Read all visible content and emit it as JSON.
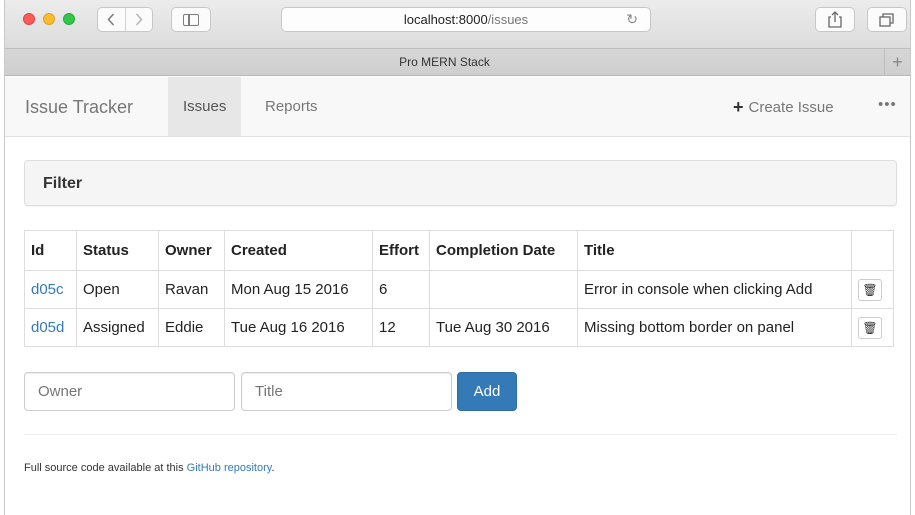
{
  "browser": {
    "url_host": "localhost:8000",
    "url_path": "/issues",
    "tab_title": "Pro MERN Stack"
  },
  "nav": {
    "brand": "Issue Tracker",
    "links": [
      "Issues",
      "Reports"
    ],
    "active": "Issues",
    "create_issue": "Create Issue"
  },
  "filter": {
    "title": "Filter"
  },
  "table": {
    "columns": [
      "Id",
      "Status",
      "Owner",
      "Created",
      "Effort",
      "Completion Date",
      "Title"
    ],
    "rows": [
      {
        "id": "d05c",
        "status": "Open",
        "owner": "Ravan",
        "created": "Mon Aug 15 2016",
        "effort": "6",
        "completion": "",
        "title": "Error in console when clicking Add"
      },
      {
        "id": "d05d",
        "status": "Assigned",
        "owner": "Eddie",
        "created": "Tue Aug 16 2016",
        "effort": "12",
        "completion": "Tue Aug 30 2016",
        "title": "Missing bottom border on panel"
      }
    ]
  },
  "form": {
    "owner_placeholder": "Owner",
    "title_placeholder": "Title",
    "add_label": "Add"
  },
  "footer": {
    "text": "Full source code available at this ",
    "link": "GitHub repository",
    "suffix": "."
  },
  "colors": {
    "link": "#337ab7",
    "primary_button": "#337ab7"
  }
}
